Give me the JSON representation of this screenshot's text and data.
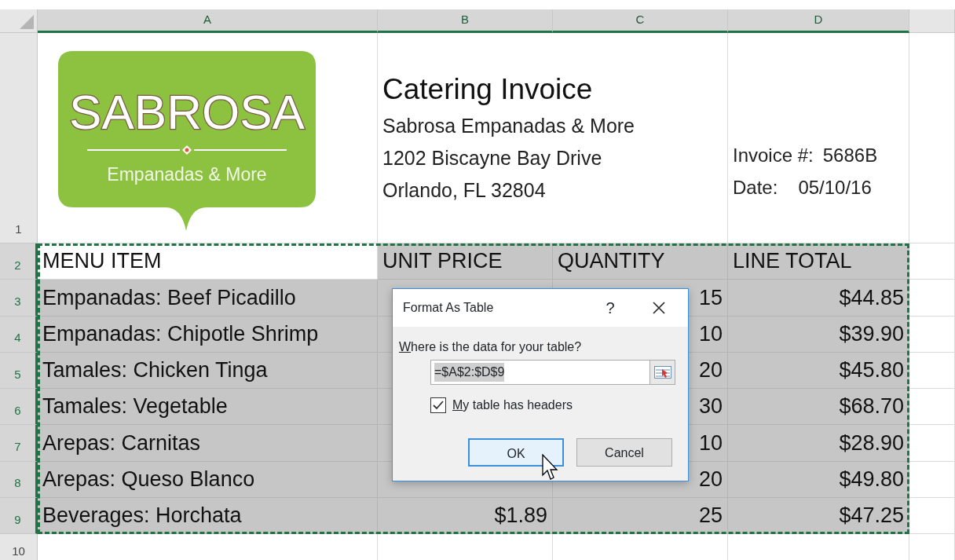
{
  "sheet": {
    "columns": [
      {
        "label": "A",
        "selected": true
      },
      {
        "label": "B",
        "selected": true
      },
      {
        "label": "C",
        "selected": true
      },
      {
        "label": "D",
        "selected": true
      }
    ],
    "row_headers": [
      {
        "label": "1",
        "selected": false
      },
      {
        "label": "2",
        "selected": true
      },
      {
        "label": "3",
        "selected": true
      },
      {
        "label": "4",
        "selected": true
      },
      {
        "label": "5",
        "selected": true
      },
      {
        "label": "6",
        "selected": true
      },
      {
        "label": "7",
        "selected": true
      },
      {
        "label": "8",
        "selected": true
      },
      {
        "label": "9",
        "selected": true
      },
      {
        "label": "10",
        "selected": false
      }
    ]
  },
  "logo": {
    "wordmark": "SABROSA",
    "tagline": "Empanadas & More"
  },
  "invoice": {
    "title": "Catering Invoice",
    "address_lines": [
      "Sabrosa Empanadas & More",
      "1202 Biscayne Bay Drive",
      "Orlando, FL 32804"
    ],
    "fields": [
      {
        "label": "Invoice #:",
        "value": "5686B"
      },
      {
        "label": "Date:",
        "value": "05/10/16"
      }
    ]
  },
  "table": {
    "header": [
      {
        "text": "MENU ITEM",
        "active": true
      },
      {
        "text": "UNIT PRICE",
        "active": false
      },
      {
        "text": "QUANTITY",
        "active": false
      },
      {
        "text": "LINE TOTAL",
        "active": false
      }
    ],
    "rows": [
      {
        "item": "Empanadas: Beef Picadillo",
        "quantity": "15",
        "line_total": "$44.85"
      },
      {
        "item": "Empanadas: Chipotle Shrimp",
        "quantity": "10",
        "line_total": "$39.90"
      },
      {
        "item": "Tamales: Chicken Tinga",
        "quantity": "20",
        "line_total": "$45.80"
      },
      {
        "item": "Tamales: Vegetable",
        "quantity": "30",
        "line_total": "$68.70"
      },
      {
        "item": "Arepas: Carnitas",
        "quantity": "10",
        "line_total": "$28.90"
      },
      {
        "item": "Arepas: Queso Blanco",
        "quantity": "20",
        "line_total": "$49.80"
      },
      {
        "item": "Beverages: Horchata",
        "unit_price": "$1.89",
        "quantity": "25",
        "line_total": "$47.25"
      }
    ]
  },
  "dialog": {
    "title": "Format As Table",
    "help": "?",
    "prompt": "Where is the data for your table?",
    "range_value": "=$A$2:$D$9",
    "headers_checkbox": {
      "label": "My table has headers",
      "checked": true
    },
    "buttons": [
      {
        "label": "OK",
        "default": true
      },
      {
        "label": "Cancel",
        "default": false
      }
    ]
  }
}
